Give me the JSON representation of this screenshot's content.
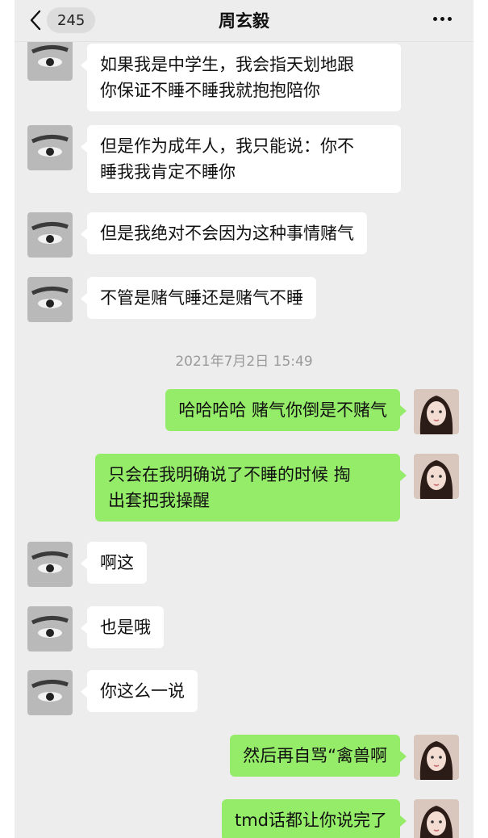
{
  "header": {
    "unread_count": "245",
    "title": "周玄毅"
  },
  "timestamp": "2021年7月2日 15:49",
  "messages": [
    {
      "side": "in",
      "lines": [
        "如果我是中学生，我会指天划地跟",
        "你保证不睡不睡我就抱抱陪你"
      ]
    },
    {
      "side": "in",
      "lines": [
        "但是作为成年人，我只能说：你不",
        "睡我我肯定不睡你"
      ]
    },
    {
      "side": "in",
      "lines": [
        "但是我绝对不会因为这种事情赌气"
      ]
    },
    {
      "side": "in",
      "lines": [
        "不管是赌气睡还是赌气不睡"
      ]
    },
    {
      "side": "out",
      "lines": [
        "哈哈哈哈 赌气你倒是不赌气"
      ]
    },
    {
      "side": "out",
      "lines": [
        "只会在我明确说了不睡的时候  掏",
        "出套把我操醒"
      ]
    },
    {
      "side": "in",
      "lines": [
        "啊这"
      ]
    },
    {
      "side": "in",
      "lines": [
        "也是哦"
      ]
    },
    {
      "side": "in",
      "lines": [
        "你这么一说"
      ]
    },
    {
      "side": "out",
      "lines": [
        "然后再自骂“禽兽啊"
      ]
    },
    {
      "side": "out",
      "lines": [
        "tmd话都让你说完了"
      ]
    }
  ],
  "colors": {
    "background": "#ededed",
    "outgoing_bubble": "#95ec69",
    "incoming_bubble": "#ffffff"
  },
  "icons": {
    "back": "chevron-left-icon",
    "more": "more-dots-icon"
  }
}
